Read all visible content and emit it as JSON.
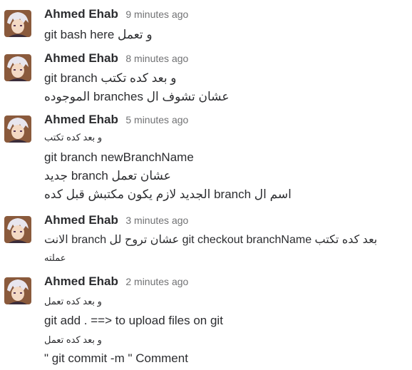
{
  "messages": [
    {
      "author": "Ahmed Ehab",
      "time": "9 minutes ago",
      "lines": [
        "git bash here و تعمل"
      ]
    },
    {
      "author": "Ahmed Ehab",
      "time": "8 minutes ago",
      "lines": [
        "git branch و بعد كده تكتب",
        "عشان تشوف ال branches الموجوده"
      ]
    },
    {
      "author": "Ahmed Ehab",
      "time": "5 minutes ago",
      "lines": [
        "و بعد كده تكتب",
        "git branch newBranchName",
        "عشان تعمل branch جديد",
        "اسم ال branch الجديد لازم يكون مكتبش قبل كده"
      ]
    },
    {
      "author": "Ahmed Ehab",
      "time": "3 minutes ago",
      "lines": [
        "بعد كده تكتب git checkout branchName عشان تروح لل branch الانت",
        "عملته"
      ]
    },
    {
      "author": "Ahmed Ehab",
      "time": "2 minutes ago",
      "lines": [
        "و بعد كده تعمل",
        "git add . ==> to upload files on git",
        "و بعد كده تعمل",
        "\" git commit -m \" Comment"
      ]
    }
  ]
}
